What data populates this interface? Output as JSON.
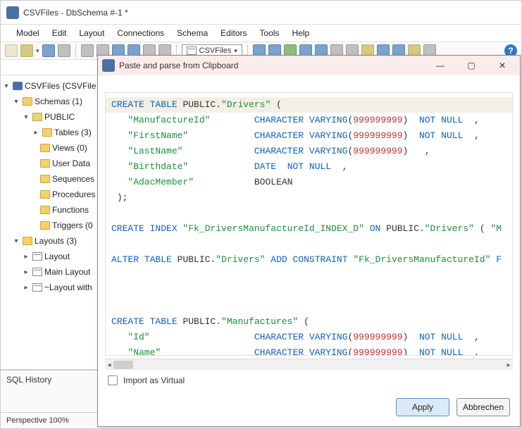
{
  "main": {
    "title": "CSVFiles - DbSchema #-1 *",
    "menu": [
      "Model",
      "Edit",
      "Layout",
      "Connections",
      "Schema",
      "Editors",
      "Tools",
      "Help"
    ],
    "tab": "CSVFiles",
    "help_icon_label": "?"
  },
  "tree": {
    "root": "CSVFiles {CSVFile",
    "schemas": {
      "label": "Schemas (1)"
    },
    "public": {
      "label": "PUBLIC"
    },
    "tables": "Tables (3)",
    "views": "Views (0)",
    "userdata": "User Data",
    "sequences": "Sequences",
    "procedures": "Procedures",
    "functions": "Functions",
    "triggers": "Triggers (0",
    "layouts": {
      "label": "Layouts (3)"
    },
    "layout1": "Layout",
    "layout2": "Main Layout",
    "layout3": "~Layout with"
  },
  "panels": {
    "sql_history": "SQL History",
    "perspective": "Perspective 100%"
  },
  "dialog": {
    "title": "Paste and parse from Clipboard",
    "checkbox": "Import as Virtual",
    "apply": "Apply",
    "cancel": "Abbrechen",
    "code_tokens": [
      [
        [
          "kw",
          "CREATE"
        ],
        [
          "sp",
          " "
        ],
        [
          "kw",
          "TABLE"
        ],
        [
          "sp",
          " "
        ],
        [
          "txt",
          "PUBLIC."
        ],
        [
          "str",
          "\"Drivers\""
        ],
        [
          "sp",
          " "
        ],
        [
          "punct",
          "("
        ]
      ],
      [
        [
          "sp",
          "   "
        ],
        [
          "str",
          "\"ManufactureId\""
        ],
        [
          "pad",
          8
        ],
        [
          "ty",
          "CHARACTER"
        ],
        [
          "sp",
          " "
        ],
        [
          "ty",
          "VARYING"
        ],
        [
          "punct",
          "("
        ],
        [
          "num",
          "999999999"
        ],
        [
          "punct",
          ")"
        ],
        [
          "sp",
          "  "
        ],
        [
          "kw",
          "NOT"
        ],
        [
          "sp",
          " "
        ],
        [
          "kw",
          "NULL"
        ],
        [
          "sp",
          "  "
        ],
        [
          "punct",
          ","
        ]
      ],
      [
        [
          "sp",
          "   "
        ],
        [
          "str",
          "\"FirstName\""
        ],
        [
          "pad",
          12
        ],
        [
          "ty",
          "CHARACTER"
        ],
        [
          "sp",
          " "
        ],
        [
          "ty",
          "VARYING"
        ],
        [
          "punct",
          "("
        ],
        [
          "num",
          "999999999"
        ],
        [
          "punct",
          ")"
        ],
        [
          "sp",
          "  "
        ],
        [
          "kw",
          "NOT"
        ],
        [
          "sp",
          " "
        ],
        [
          "kw",
          "NULL"
        ],
        [
          "sp",
          "  "
        ],
        [
          "punct",
          ","
        ]
      ],
      [
        [
          "sp",
          "   "
        ],
        [
          "str",
          "\"LastName\""
        ],
        [
          "pad",
          13
        ],
        [
          "ty",
          "CHARACTER"
        ],
        [
          "sp",
          " "
        ],
        [
          "ty",
          "VARYING"
        ],
        [
          "punct",
          "("
        ],
        [
          "num",
          "999999999"
        ],
        [
          "punct",
          ")"
        ],
        [
          "sp",
          "   "
        ],
        [
          "punct",
          ","
        ]
      ],
      [
        [
          "sp",
          "   "
        ],
        [
          "str",
          "\"Birthdate\""
        ],
        [
          "pad",
          12
        ],
        [
          "ty",
          "DATE"
        ],
        [
          "sp",
          "  "
        ],
        [
          "kw",
          "NOT"
        ],
        [
          "sp",
          " "
        ],
        [
          "kw",
          "NULL"
        ],
        [
          "sp",
          "  "
        ],
        [
          "punct",
          ","
        ]
      ],
      [
        [
          "sp",
          "   "
        ],
        [
          "str",
          "\"AdacMember\""
        ],
        [
          "pad",
          11
        ],
        [
          "txt",
          "BOOLEAN"
        ]
      ],
      [
        [
          "sp",
          " "
        ],
        [
          "punct",
          ");"
        ]
      ],
      [],
      [
        [
          "kw",
          "CREATE"
        ],
        [
          "sp",
          " "
        ],
        [
          "kw",
          "INDEX"
        ],
        [
          "sp",
          " "
        ],
        [
          "str",
          "\"Fk_DriversManufactureId_INDEX_D\""
        ],
        [
          "sp",
          " "
        ],
        [
          "kw",
          "ON"
        ],
        [
          "sp",
          " "
        ],
        [
          "txt",
          "PUBLIC."
        ],
        [
          "str",
          "\"Drivers\""
        ],
        [
          "sp",
          " "
        ],
        [
          "punct",
          "("
        ],
        [
          "sp",
          " "
        ],
        [
          "str",
          "\"M"
        ]
      ],
      [],
      [
        [
          "kw",
          "ALTER"
        ],
        [
          "sp",
          " "
        ],
        [
          "kw",
          "TABLE"
        ],
        [
          "sp",
          " "
        ],
        [
          "txt",
          "PUBLIC."
        ],
        [
          "str",
          "\"Drivers\""
        ],
        [
          "sp",
          " "
        ],
        [
          "kw",
          "ADD"
        ],
        [
          "sp",
          " "
        ],
        [
          "kw",
          "CONSTRAINT"
        ],
        [
          "sp",
          " "
        ],
        [
          "str",
          "\"Fk_DriversManufactureId\""
        ],
        [
          "sp",
          " "
        ],
        [
          "kw",
          "F"
        ]
      ],
      [],
      [],
      [],
      [
        [
          "kw",
          "CREATE"
        ],
        [
          "sp",
          " "
        ],
        [
          "kw",
          "TABLE"
        ],
        [
          "sp",
          " "
        ],
        [
          "txt",
          "PUBLIC."
        ],
        [
          "str",
          "\"Manufactures\""
        ],
        [
          "sp",
          " "
        ],
        [
          "punct",
          "("
        ]
      ],
      [
        [
          "sp",
          "   "
        ],
        [
          "str",
          "\"Id\""
        ],
        [
          "pad",
          19
        ],
        [
          "ty",
          "CHARACTER"
        ],
        [
          "sp",
          " "
        ],
        [
          "ty",
          "VARYING"
        ],
        [
          "punct",
          "("
        ],
        [
          "num",
          "999999999"
        ],
        [
          "punct",
          ")"
        ],
        [
          "sp",
          "  "
        ],
        [
          "kw",
          "NOT"
        ],
        [
          "sp",
          " "
        ],
        [
          "kw",
          "NULL"
        ],
        [
          "sp",
          "  "
        ],
        [
          "punct",
          ","
        ]
      ],
      [
        [
          "sp",
          "   "
        ],
        [
          "str",
          "\"Name\""
        ],
        [
          "pad",
          17
        ],
        [
          "ty",
          "CHARACTER"
        ],
        [
          "sp",
          " "
        ],
        [
          "ty",
          "VARYING"
        ],
        [
          "punct",
          "("
        ],
        [
          "num",
          "999999999"
        ],
        [
          "punct",
          ")"
        ],
        [
          "sp",
          "  "
        ],
        [
          "kw",
          "NOT"
        ],
        [
          "sp",
          " "
        ],
        [
          "kw",
          "NULL"
        ],
        [
          "sp",
          "  "
        ],
        [
          "punct",
          ","
        ]
      ]
    ]
  }
}
